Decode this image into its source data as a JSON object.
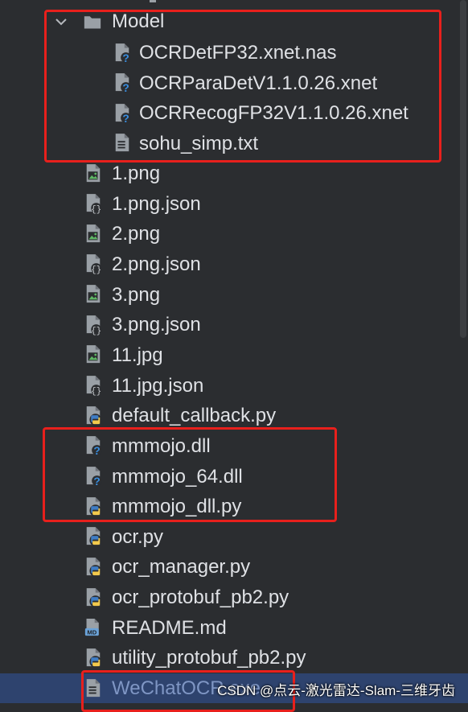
{
  "tree": {
    "folder": {
      "name": "Model",
      "expanded": true
    },
    "model_files": [
      {
        "name": "OCRDetFP32.xnet.nas",
        "icon": "unknown-file-icon"
      },
      {
        "name": "OCRParaDetV1.1.0.26.xnet",
        "icon": "unknown-file-icon"
      },
      {
        "name": "OCRRecogFP32V1.1.0.26.xnet",
        "icon": "unknown-file-icon"
      },
      {
        "name": "sohu_simp.txt",
        "icon": "text-file-icon"
      }
    ],
    "files": [
      {
        "name": "1.png",
        "icon": "image-file-icon"
      },
      {
        "name": "1.png.json",
        "icon": "json-file-icon"
      },
      {
        "name": "2.png",
        "icon": "image-file-icon"
      },
      {
        "name": "2.png.json",
        "icon": "json-file-icon"
      },
      {
        "name": "3.png",
        "icon": "image-file-icon"
      },
      {
        "name": "3.png.json",
        "icon": "json-file-icon"
      },
      {
        "name": "11.jpg",
        "icon": "image-file-icon"
      },
      {
        "name": "11.jpg.json",
        "icon": "json-file-icon"
      },
      {
        "name": "default_callback.py",
        "icon": "python-file-icon"
      },
      {
        "name": "mmmojo.dll",
        "icon": "unknown-file-icon"
      },
      {
        "name": "mmmojo_64.dll",
        "icon": "unknown-file-icon"
      },
      {
        "name": "mmmojo_dll.py",
        "icon": "python-file-icon"
      },
      {
        "name": "ocr.py",
        "icon": "python-file-icon"
      },
      {
        "name": "ocr_manager.py",
        "icon": "python-file-icon"
      },
      {
        "name": "ocr_protobuf_pb2.py",
        "icon": "python-file-icon"
      },
      {
        "name": "README.md",
        "icon": "markdown-file-icon"
      },
      {
        "name": "utility_protobuf_pb2.py",
        "icon": "python-file-icon"
      },
      {
        "name": "WeChatOCR.exe",
        "icon": "text-file-icon",
        "selected": true
      }
    ]
  },
  "watermark": "CSDN @点云-激光雷达-Slam-三维牙齿",
  "colors": {
    "background": "#2b2d30",
    "selection": "#2e436e",
    "highlight_box": "#e8201c",
    "python_blue": "#3f7cc4",
    "python_yellow": "#f2c94c",
    "question_blue": "#3a8fe0"
  }
}
